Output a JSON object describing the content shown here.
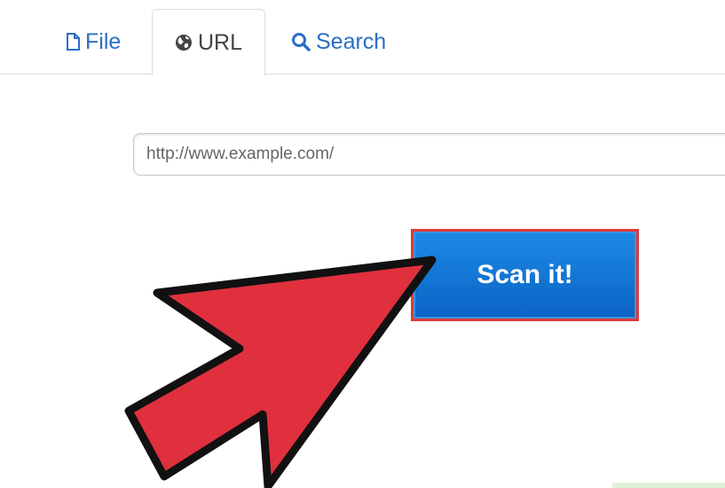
{
  "tabs": {
    "file": {
      "label": "File",
      "icon": "file-icon"
    },
    "url": {
      "label": "URL",
      "icon": "globe-icon",
      "active": true
    },
    "search": {
      "label": "Search",
      "icon": "search-icon"
    }
  },
  "url_input": {
    "placeholder": "http://www.example.com/",
    "value": ""
  },
  "scan_button": {
    "label": "Scan it!"
  },
  "annotation": {
    "icon": "pointer-arrow-icon",
    "color": "#e0303e",
    "highlight_color": "#e03b3b"
  },
  "colors": {
    "link": "#2a6fc4",
    "button_top": "#1d8be6",
    "button_bottom": "#0a62c4"
  }
}
